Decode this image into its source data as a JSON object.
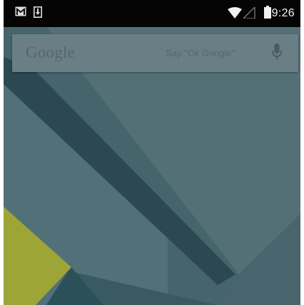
{
  "status_bar": {
    "time": "9:26",
    "icons": [
      "gmail-icon",
      "download-icon",
      "wifi-icon",
      "signal-icon",
      "battery-icon"
    ]
  },
  "search_widget": {
    "logo_text": "Google",
    "hint_text": "Say \"Ok Google\"",
    "mic_icon": "mic-icon"
  },
  "colors": {
    "status_bar": "#050505",
    "wallpaper_base": "#4a6b73",
    "search_bar": "#6a7f85",
    "accent_yellow": "#a7b03a"
  }
}
